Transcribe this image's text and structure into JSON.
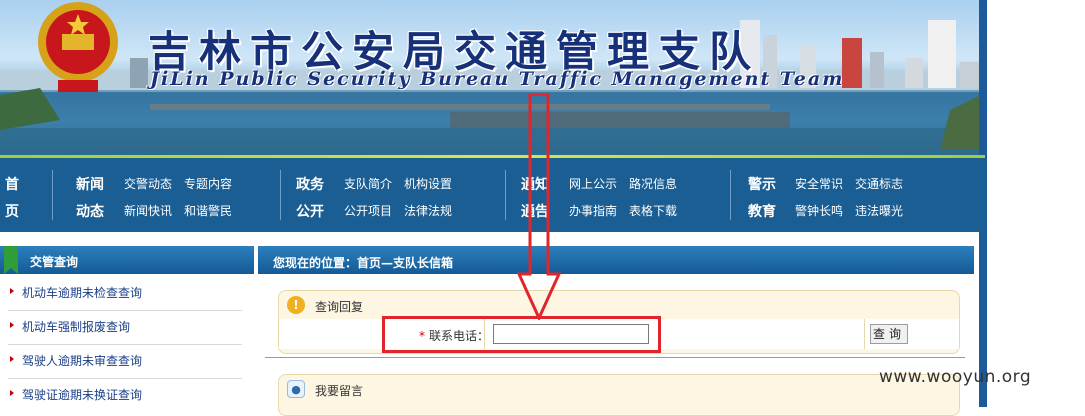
{
  "banner": {
    "title_cn": "吉林市公安局交通管理支队",
    "title_en": "JiLin Public Security Bureau Traffic Management Team"
  },
  "nav": {
    "home": [
      "首",
      "页"
    ],
    "groups": [
      {
        "heading": [
          "新闻",
          "动态"
        ],
        "items_row1": [
          "交警动态",
          "专题内容"
        ],
        "items_row2": [
          "新闻快讯",
          "和谐警民"
        ]
      },
      {
        "heading": [
          "政务",
          "公开"
        ],
        "items_row1": [
          "支队简介",
          "机构设置"
        ],
        "items_row2": [
          "公开项目",
          "法律法规"
        ]
      },
      {
        "heading": [
          "通知",
          "通告"
        ],
        "items_row1": [
          "网上公示",
          "路况信息"
        ],
        "items_row2": [
          "办事指南",
          "表格下载"
        ]
      },
      {
        "heading": [
          "警示",
          "教育"
        ],
        "items_row1": [
          "安全常识",
          "交通标志"
        ],
        "items_row2": [
          "警钟长鸣",
          "违法曝光"
        ]
      }
    ]
  },
  "sidebar": {
    "title": "交管查询",
    "items": [
      {
        "label": "机动车逾期未检查查询"
      },
      {
        "label": "机动车强制报废查询"
      },
      {
        "label": "驾驶人逾期未审查查询"
      },
      {
        "label": "驾驶证逾期未换证查询"
      }
    ]
  },
  "main": {
    "breadcrumb": "您现在的位置：首页—支队长信箱",
    "query_panel": {
      "title": "查询回复",
      "required_mark": "*",
      "phone_label": "联系电话：",
      "phone_value": "",
      "search_button": "查询"
    },
    "message_panel": {
      "title": "我要留言"
    }
  },
  "watermark": "www.wooyun.org",
  "colors": {
    "nav_bg": "#1b5e94",
    "header_bar": "#145a95",
    "panel_bg": "#fdf6e2",
    "annotation_red": "#e0252b"
  }
}
